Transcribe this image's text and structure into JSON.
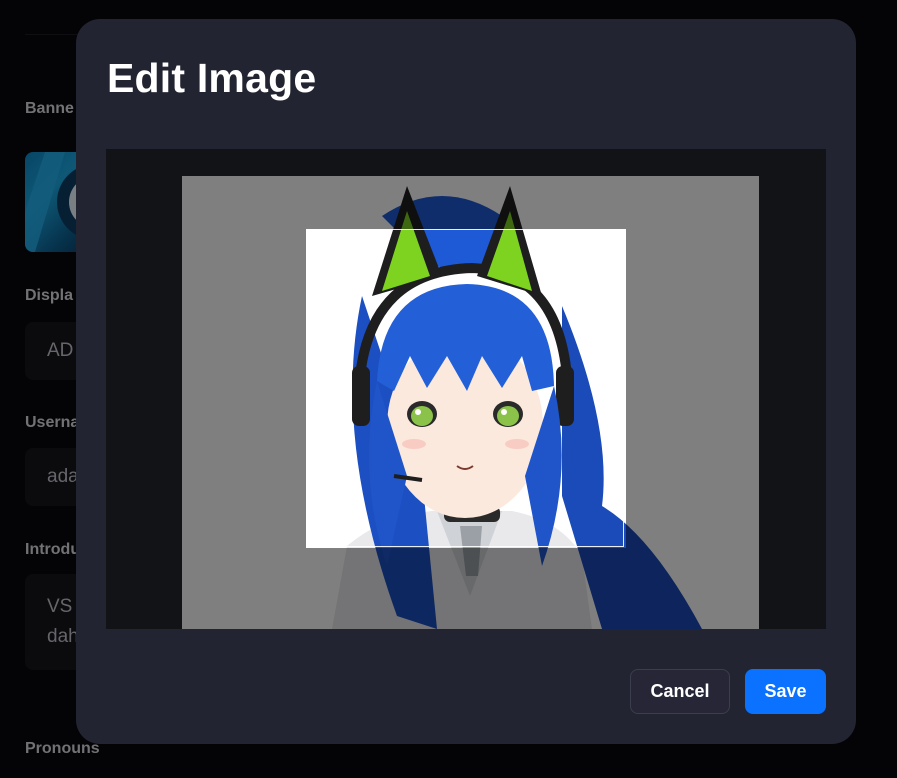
{
  "background_form": {
    "labels": {
      "banner": "Banne",
      "display_name": "Displa",
      "username": "Userna",
      "introduction": "Introdu",
      "pronouns": "Pronouns"
    },
    "fields": {
      "display_name_value": "AD",
      "username_value": "ada",
      "introduction_line1": "VS",
      "introduction_line2": "dah"
    }
  },
  "modal": {
    "title": "Edit Image",
    "cancel_label": "Cancel",
    "save_label": "Save"
  },
  "colors": {
    "accent": "#0b72ff",
    "modal_bg": "#232431",
    "page_bg": "#08080d",
    "hair": "#1d56c8",
    "ears": "#7ed321"
  },
  "icons": {
    "banner_thumbnail": "banner-image",
    "avatar_image": "anime-avatar-illustration"
  }
}
